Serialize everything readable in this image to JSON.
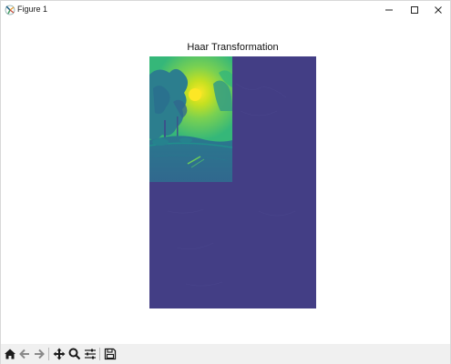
{
  "window": {
    "title": "Figure 1"
  },
  "figure": {
    "title": "Haar Transformation",
    "colormap": "viridis",
    "background_color": "#433e85"
  },
  "toolbar": {
    "buttons": [
      {
        "name": "home-button",
        "icon": "home-icon"
      },
      {
        "name": "back-button",
        "icon": "arrow-left-icon"
      },
      {
        "name": "forward-button",
        "icon": "arrow-right-icon"
      },
      {
        "name": "pan-button",
        "icon": "move-icon"
      },
      {
        "name": "zoom-button",
        "icon": "magnifier-icon"
      },
      {
        "name": "configure-subplots-button",
        "icon": "sliders-icon"
      },
      {
        "name": "save-button",
        "icon": "floppy-disk-icon"
      }
    ]
  }
}
